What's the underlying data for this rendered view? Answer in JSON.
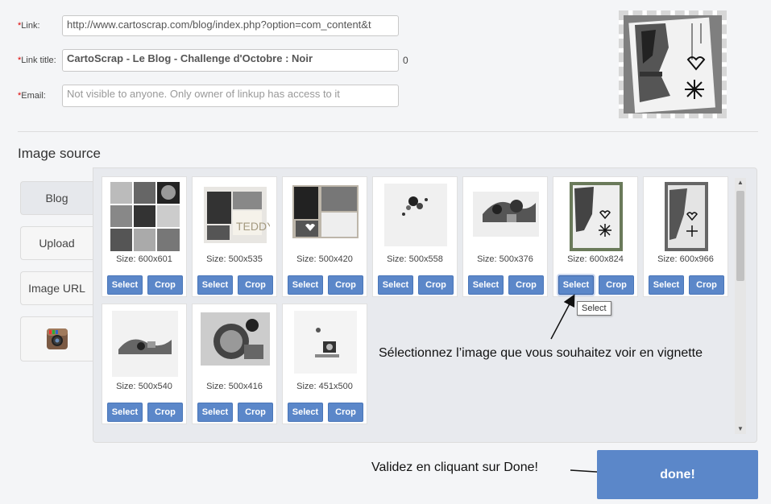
{
  "form": {
    "link": {
      "label": "Link:",
      "value": "http://www.cartoscrap.com/blog/index.php?option=com_content&t"
    },
    "link_title": {
      "label": "Link title:",
      "value": "CartoScrap - Le Blog - Challenge d'Octobre : Noir",
      "counter": "0"
    },
    "email": {
      "label": "Email:",
      "placeholder": "Not visible to anyone. Only owner of linkup has access to it"
    },
    "required_mark": "*"
  },
  "image_source": {
    "title": "Image source",
    "tabs": [
      {
        "label": "Blog",
        "active": true
      },
      {
        "label": "Upload"
      },
      {
        "label": "Image URL"
      },
      {
        "label": "",
        "icon": "instagram-icon"
      }
    ]
  },
  "images": [
    {
      "size": "Size: 600x601"
    },
    {
      "size": "Size: 500x535"
    },
    {
      "size": "Size: 500x420"
    },
    {
      "size": "Size: 500x558"
    },
    {
      "size": "Size: 500x376"
    },
    {
      "size": "Size: 600x824"
    },
    {
      "size": "Size: 600x966"
    },
    {
      "size": "Size: 500x540"
    },
    {
      "size": "Size: 500x416"
    },
    {
      "size": "Size: 451x500"
    }
  ],
  "buttons": {
    "select": "Select",
    "crop": "Crop",
    "done": "done!"
  },
  "tooltip": "Select",
  "annotations": {
    "select_hint": "Sélectionnez l’image que vous souhaitez voir en vignette",
    "done_hint": "Validez en cliquant sur Done!"
  },
  "colors": {
    "accent": "#5b87c9",
    "required": "#dd0000"
  }
}
